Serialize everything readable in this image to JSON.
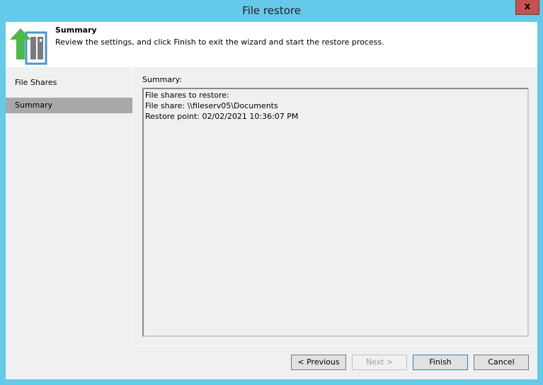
{
  "window": {
    "title": "File restore",
    "close_label": "x"
  },
  "header": {
    "title": "Summary",
    "description": "Review the settings, and click Finish to exit the wizard and start the restore process."
  },
  "nav": [
    {
      "label": "File Shares",
      "selected": false
    },
    {
      "label": "Summary",
      "selected": true
    }
  ],
  "summary": {
    "label": "Summary:",
    "lines": [
      "File shares to restore:",
      "File share: \\\\fileserv05\\Documents",
      "Restore point: 02/02/2021 10:36:07 PM"
    ]
  },
  "buttons": {
    "previous": "< Previous",
    "next": "Next >",
    "finish": "Finish",
    "cancel": "Cancel"
  }
}
